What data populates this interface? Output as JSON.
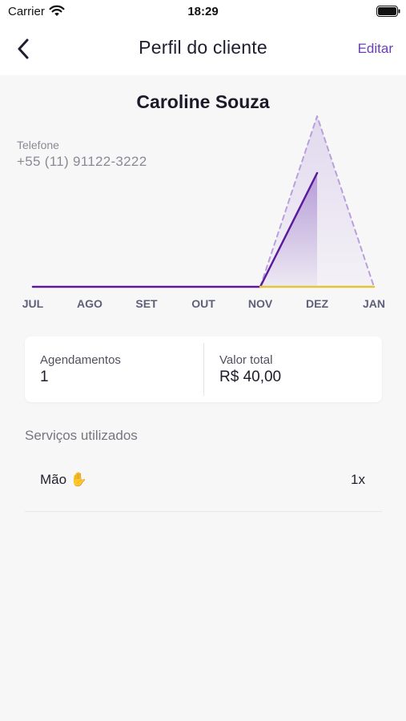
{
  "status_bar": {
    "carrier": "Carrier",
    "time": "18:29",
    "icons": [
      "wifi-icon",
      "battery-icon"
    ]
  },
  "nav": {
    "title": "Perfil do cliente",
    "edit_label": "Editar",
    "back_icon": "chevron-left-icon",
    "accent_color": "#6b3fb3"
  },
  "client": {
    "name": "Caroline Souza",
    "phone_label": "Telefone",
    "phone": "+55 (11) 91122-3222"
  },
  "chart_data": {
    "type": "line",
    "categories": [
      "JUL",
      "AGO",
      "SET",
      "OUT",
      "NOV",
      "DEZ",
      "JAN"
    ],
    "series": [
      {
        "values": [
          0,
          0,
          0,
          0,
          0,
          1,
          null
        ],
        "color": "#5b1a9c",
        "style": "solid",
        "fill": "gradient"
      },
      {
        "values": [
          null,
          null,
          null,
          null,
          0,
          1.5,
          0
        ],
        "color": "#b9a0db",
        "style": "dashed",
        "fill": "gradient"
      },
      {
        "values": [
          null,
          null,
          null,
          null,
          0,
          0,
          0
        ],
        "color": "#e5c33b",
        "style": "solid"
      }
    ],
    "ylim": [
      0,
      1.5
    ],
    "grid": false
  },
  "stats": {
    "appointments_label": "Agendamentos",
    "appointments_value": "1",
    "total_label": "Valor total",
    "total_value": "R$ 40,00"
  },
  "services": {
    "header": "Serviços utilizados",
    "items": [
      {
        "name": "Mão ✋",
        "count": "1x"
      }
    ]
  }
}
